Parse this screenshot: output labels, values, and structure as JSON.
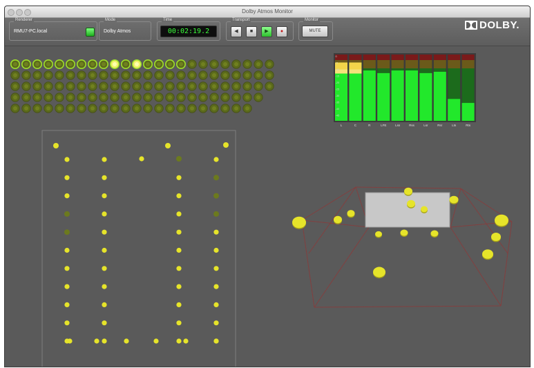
{
  "window": {
    "title": "Dolby Atmos Monitor"
  },
  "toolbar": {
    "renderer": {
      "label": "Renderer",
      "value": "RMU7-PC.local"
    },
    "mode": {
      "label": "Mode",
      "value": "Dolby Atmos"
    },
    "time": {
      "label": "Time",
      "value": "00:02:19.2"
    },
    "transport": {
      "label": "Transport",
      "buttons": [
        {
          "name": "rewind",
          "glyph": "◀"
        },
        {
          "name": "stop",
          "glyph": "■"
        },
        {
          "name": "play",
          "glyph": "▶"
        },
        {
          "name": "record",
          "glyph": "●"
        }
      ]
    },
    "monitor": {
      "label": "Monitor",
      "mute_label": "MUTE"
    },
    "logo": "DOLBY."
  },
  "object_grid": {
    "rows": 5,
    "columns": 24,
    "counts_per_row": [
      24,
      24,
      24,
      23,
      22
    ],
    "highlighted": [
      [
        0,
        9
      ],
      [
        0,
        11
      ]
    ],
    "active_count_row0": 16
  },
  "meters": {
    "channels": [
      "L",
      "C",
      "R",
      "LFE",
      "Lss",
      "Rss",
      "Lsr",
      "Rsr",
      "Lts",
      "Rts"
    ],
    "levels": [
      0.88,
      0.88,
      0.76,
      0.72,
      0.76,
      0.76,
      0.72,
      0.74,
      0.33,
      0.27
    ],
    "peak_hold": [
      true,
      true,
      false,
      false,
      false,
      false,
      false,
      false,
      false,
      false
    ],
    "ticks": [
      "0",
      "-5",
      "-10",
      "-15",
      "-20",
      "-25",
      "-30",
      "-35",
      "-40",
      "-45"
    ]
  },
  "speaker_layout_2d": {
    "rows": 12,
    "columns": 6,
    "dim_speakers": [
      [
        3,
        1
      ],
      [
        4,
        1
      ],
      [
        1,
        4
      ],
      [
        2,
        4
      ],
      [
        3,
        4
      ],
      [
        4,
        5
      ]
    ],
    "outer_marks": 3,
    "bottom_row_count": 6
  },
  "room_3d": {
    "object_count": 15
  },
  "colors": {
    "window_bg": "#5a5a5a",
    "meter_green": "#22e82b",
    "meter_yellow": "#e4c44a",
    "meter_red": "#7a1a1a",
    "speaker_active": "#e6e42a",
    "speaker_dim": "#6c7a1e",
    "room_outline": "#8a3b3b"
  }
}
